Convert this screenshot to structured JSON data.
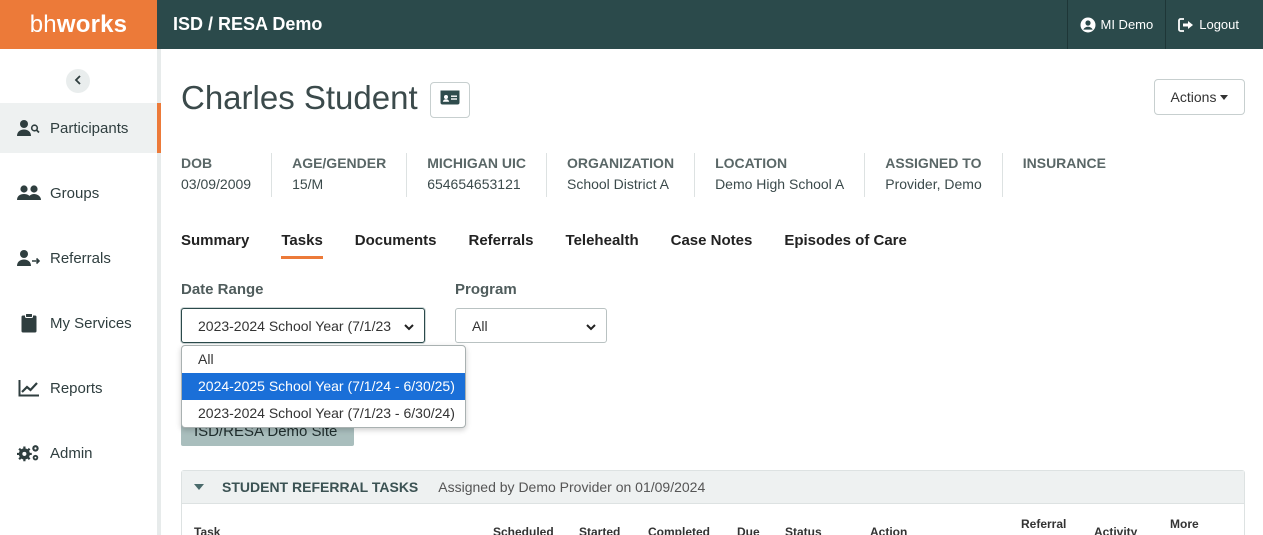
{
  "header": {
    "logo_light": "bh",
    "logo_bold": "works",
    "app_title": "ISD / RESA Demo",
    "user_label": "MI Demo",
    "logout_label": "Logout"
  },
  "sidebar": {
    "items": [
      {
        "label": "Participants",
        "icon": "participant-search-icon",
        "active": true
      },
      {
        "label": "Groups",
        "icon": "users-icon"
      },
      {
        "label": "Referrals",
        "icon": "user-arrow-icon"
      },
      {
        "label": "My Services",
        "icon": "clipboard-icon"
      },
      {
        "label": "Reports",
        "icon": "chart-line-icon"
      },
      {
        "label": "Admin",
        "icon": "gears-icon"
      }
    ]
  },
  "student": {
    "name": "Charles Student",
    "actions_label": "Actions",
    "info": [
      {
        "label": "DOB",
        "value": "03/09/2009"
      },
      {
        "label": "AGE/GENDER",
        "value": "15/M"
      },
      {
        "label": "MICHIGAN UIC",
        "value": "654654653121"
      },
      {
        "label": "ORGANIZATION",
        "value": "School District A"
      },
      {
        "label": "LOCATION",
        "value": "Demo High School A"
      },
      {
        "label": "ASSIGNED TO",
        "value": "Provider, Demo"
      },
      {
        "label": "INSURANCE",
        "value": ""
      }
    ]
  },
  "tabs": [
    "Summary",
    "Tasks",
    "Documents",
    "Referrals",
    "Telehealth",
    "Case Notes",
    "Episodes of Care"
  ],
  "active_tab": "Tasks",
  "filters": {
    "date_range_label": "Date Range",
    "date_range_value": "2023-2024 School Year (7/1/23",
    "program_label": "Program",
    "program_value": "All",
    "date_range_options": [
      {
        "label": "All"
      },
      {
        "label": "2024-2025 School Year (7/1/24 - 6/30/25)",
        "highlighted": true
      },
      {
        "label": "2023-2024 School Year (7/1/23 - 6/30/24)"
      }
    ]
  },
  "site_chip": "ISD/RESA Demo Site",
  "task_panel": {
    "title": "STUDENT REFERRAL TASKS",
    "subtitle": "Assigned by Demo Provider on 01/09/2024",
    "columns": [
      "Task",
      "Scheduled",
      "Started",
      "Completed",
      "Due",
      "Status",
      "Action",
      "Referral",
      "Activity",
      "More"
    ]
  },
  "colors": {
    "topbar": "#2b4a4b",
    "brand_orange": "#ec7a39",
    "dropdown_highlight": "#1a6fd8"
  }
}
